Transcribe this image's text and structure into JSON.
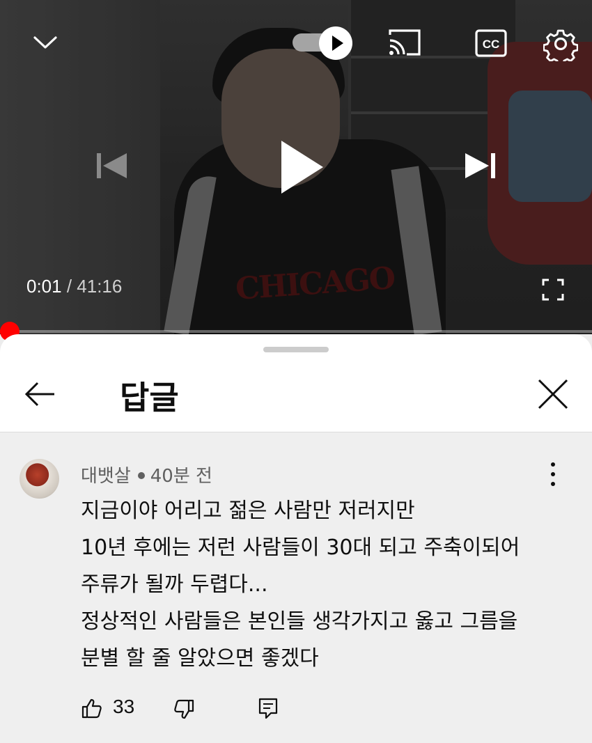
{
  "player": {
    "current_time": "0:01",
    "separator": " / ",
    "duration": "41:16",
    "progress_fraction": 0.0004,
    "chest_print": "CHICAGO",
    "icons": [
      "chevron-down-icon",
      "autoplay-toggle",
      "cast-icon",
      "captions-icon",
      "settings-icon",
      "previous-icon",
      "play-icon",
      "next-icon",
      "fullscreen-icon"
    ],
    "accent_color": "#ff0000"
  },
  "sheet": {
    "title": "답글",
    "back_icon": "arrow-left-icon",
    "close_icon": "close-icon"
  },
  "comment": {
    "author": "대뱃살",
    "time": "40분 전",
    "lines": [
      "지금이야 어리고 젊은 사람만 저러지만",
      "10년 후에는 저런 사람들이 30대 되고 주축이되어",
      "주류가 될까 두렵다...",
      "정상적인 사람들은 본인들 생각가지고 옳고 그름을",
      "분별 할 줄 알았으면 좋겠다"
    ],
    "likes": "33",
    "icons": [
      "thumbs-up-icon",
      "thumbs-down-icon",
      "reply-icon",
      "more-vert-icon"
    ]
  }
}
